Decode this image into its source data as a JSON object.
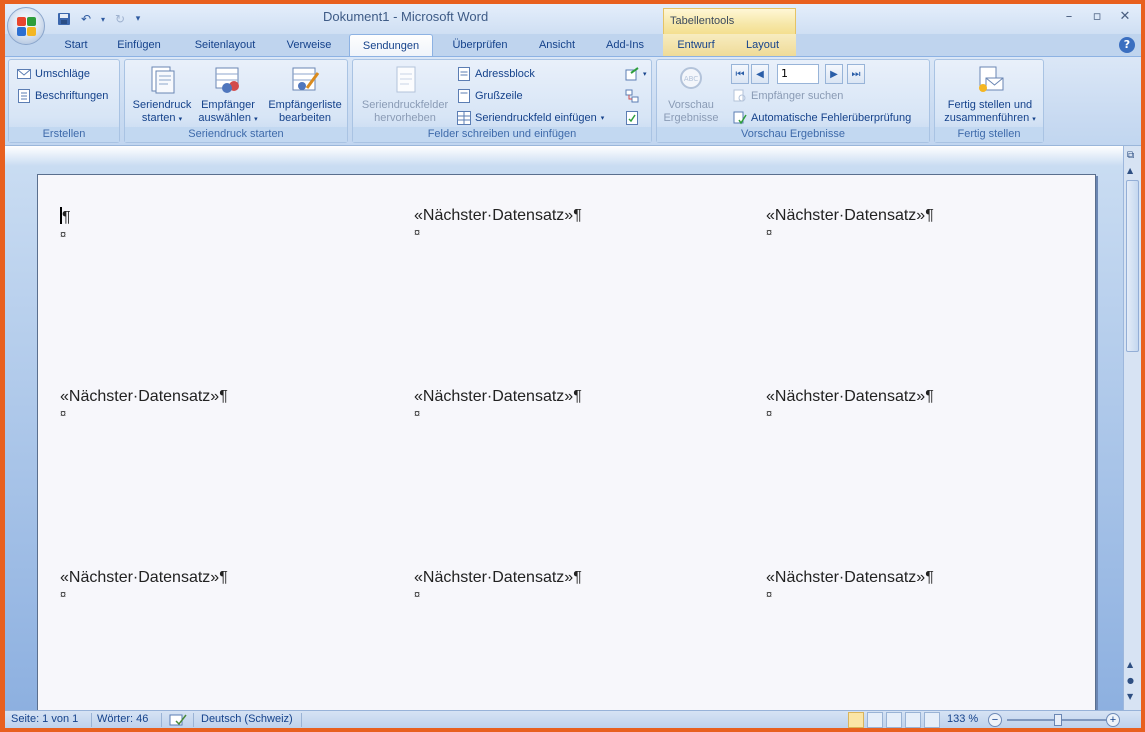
{
  "window": {
    "title": "Dokument1 - Microsoft Word",
    "contextual_header": "Tabellentools",
    "controls": [
      "–",
      "▫",
      "✕"
    ]
  },
  "tabs": {
    "start": "Start",
    "einfuegen": "Einfügen",
    "seitenlayout": "Seitenlayout",
    "verweise": "Verweise",
    "sendungen": "Sendungen",
    "ueberpruefen": "Überprüfen",
    "ansicht": "Ansicht",
    "addins": "Add-Ins",
    "entwurf": "Entwurf",
    "layout": "Layout",
    "active": "Sendungen"
  },
  "ribbon": {
    "erstellen": {
      "label": "Erstellen",
      "umschlaege": "Umschläge",
      "beschriftungen": "Beschriftungen"
    },
    "seriendruck_starten": {
      "label": "Seriendruck starten",
      "starten_line1": "Seriendruck",
      "starten_line2": "starten",
      "empfaenger_line1": "Empfänger",
      "empfaenger_line2": "auswählen",
      "liste_line1": "Empfängerliste",
      "liste_line2": "bearbeiten"
    },
    "felder": {
      "label": "Felder schreiben und einfügen",
      "hervorheben_line1": "Seriendruckfelder",
      "hervorheben_line2": "hervorheben",
      "adressblock": "Adressblock",
      "grusszeile": "Grußzeile",
      "feld_einfuegen": "Seriendruckfeld einfügen"
    },
    "vorschau": {
      "label": "Vorschau Ergebnisse",
      "vorschau_line1": "Vorschau",
      "vorschau_line2": "Ergebnisse",
      "record_number": "1",
      "empfaenger_suchen": "Empfänger suchen",
      "fehlerueberpruefung": "Automatische Fehlerüberprüfung"
    },
    "fertig": {
      "label": "Fertig stellen",
      "btn_line1": "Fertig stellen und",
      "btn_line2": "zusammenführen"
    }
  },
  "document": {
    "cells": [
      {
        "text": "¶",
        "mark": "¤"
      },
      {
        "text": "«Nächster·Datensatz»¶",
        "mark": "¤"
      },
      {
        "text": "«Nächster·Datensatz»¶",
        "mark": "¤"
      },
      {
        "text": "«Nächster·Datensatz»¶",
        "mark": "¤"
      },
      {
        "text": "«Nächster·Datensatz»¶",
        "mark": "¤"
      },
      {
        "text": "«Nächster·Datensatz»¶",
        "mark": "¤"
      },
      {
        "text": "«Nächster·Datensatz»¶",
        "mark": "¤"
      },
      {
        "text": "«Nächster·Datensatz»¶",
        "mark": "¤"
      },
      {
        "text": "«Nächster·Datensatz»¶",
        "mark": "¤"
      }
    ]
  },
  "statusbar": {
    "page": "Seite: 1 von 1",
    "words": "Wörter: 46",
    "language": "Deutsch (Schweiz)",
    "zoom": "133 %",
    "zoom_minus": "−",
    "zoom_plus": "+"
  },
  "colors": {
    "frame_border": "#e8601f",
    "ribbon_text": "#15428b",
    "contextual_tab": "#f6e7a8"
  }
}
